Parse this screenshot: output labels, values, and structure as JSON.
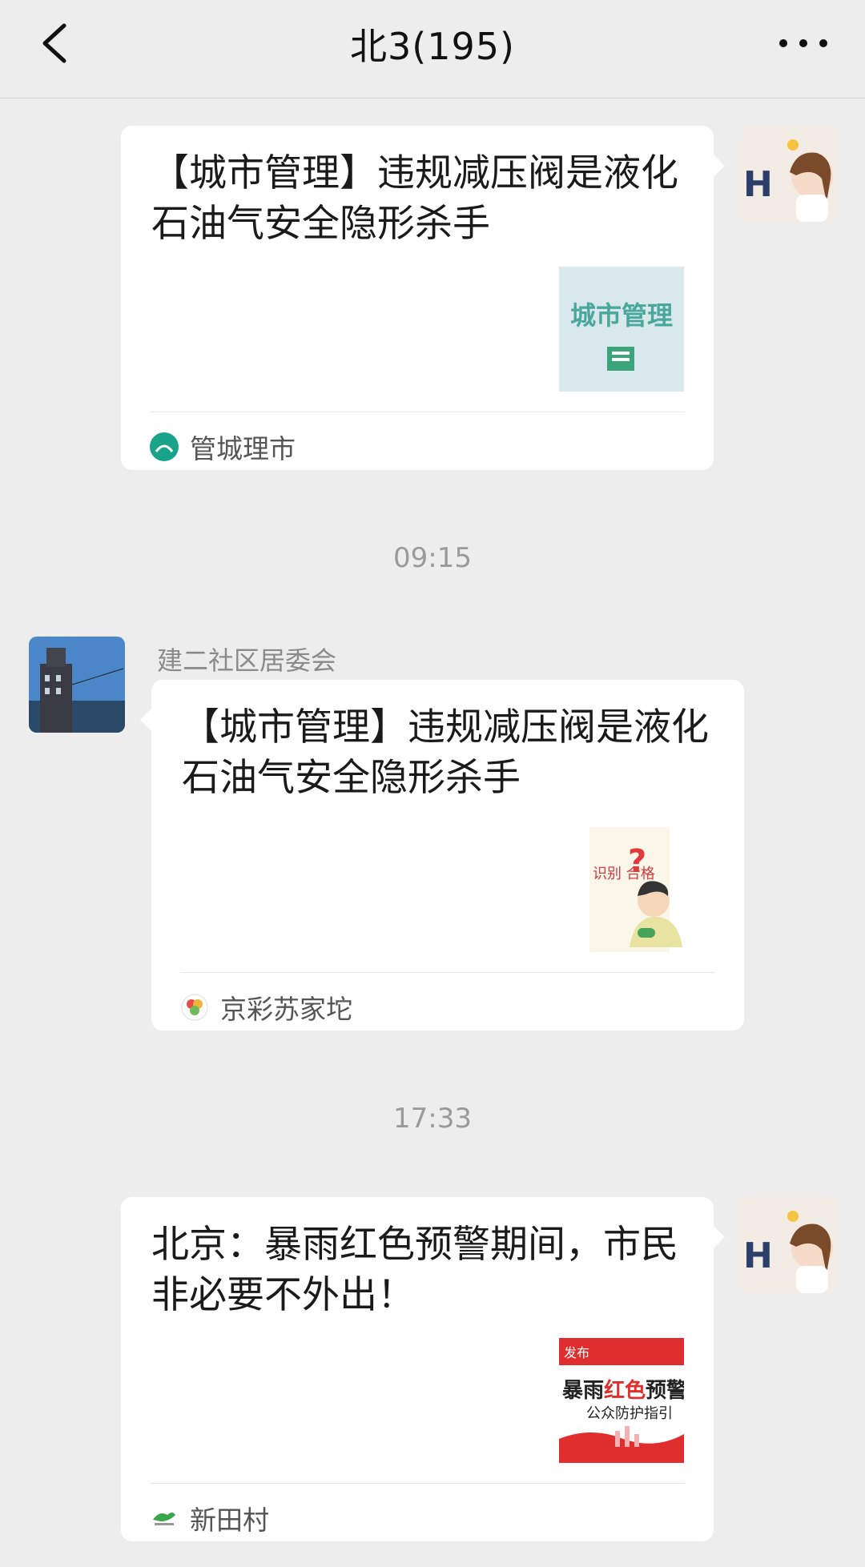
{
  "header": {
    "title": "北3(195)",
    "back_icon": "chevron-left-icon",
    "more_icon": "more-dots-icon"
  },
  "messages": [
    {
      "card_title": "【城市管理】违规减压阀是液化石油气安全隐形杀手",
      "source": "管城理市",
      "thumb_text": "城市管理"
    },
    {
      "time": "09:15",
      "sender": "建二社区居委会",
      "card_title": "【城市管理】违规减压阀是液化石油气安全隐形杀手",
      "source": "京彩苏家坨",
      "thumb_text": "识别 合格"
    },
    {
      "time": "17:33",
      "card_title": "北京：暴雨红色预警期间，市民非必要不外出！",
      "source": "新田村",
      "thumb_text_1": "发布",
      "thumb_text_2a": "暴雨",
      "thumb_text_2b": "红色",
      "thumb_text_2c": "预警",
      "thumb_text_3": "公众防护指引"
    }
  ],
  "colors": {
    "background": "#ededed",
    "card": "#ffffff",
    "alert_red": "#e02d2d"
  }
}
